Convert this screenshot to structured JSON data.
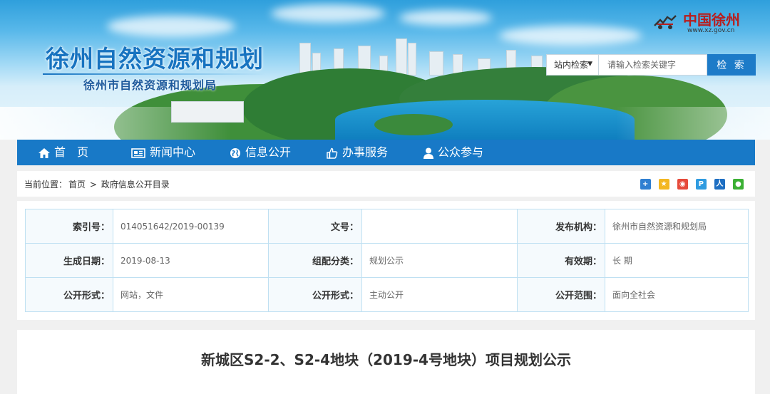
{
  "header": {
    "site_title": "徐州自然资源和规划",
    "site_subtitle": "徐州市自然资源和规划局",
    "logo": {
      "text": "中国徐州",
      "url": "www.xz.gov.cn"
    },
    "search": {
      "scope_label": "站内检索",
      "placeholder": "请输入检索关键字",
      "button_label": "检 索"
    }
  },
  "nav": {
    "items": [
      {
        "label": "首　页",
        "icon": "home-icon"
      },
      {
        "label": "新闻中心",
        "icon": "newspaper-icon"
      },
      {
        "label": "信息公开",
        "icon": "globe-icon"
      },
      {
        "label": "办事服务",
        "icon": "thumbs-up-icon"
      },
      {
        "label": "公众参与",
        "icon": "user-icon"
      }
    ]
  },
  "breadcrumb": {
    "prefix": "当前位置：",
    "home": "首页",
    "separator": ">",
    "current": "政府信息公开目录"
  },
  "share_icons": [
    "plus-share-icon",
    "qzone-icon",
    "weibo-icon",
    "pengyou-icon",
    "renren-icon",
    "wechat-icon"
  ],
  "meta": {
    "index_no": {
      "label": "索引号：",
      "value": "014051642/2019-00139"
    },
    "doc_no": {
      "label": "文号：",
      "value": ""
    },
    "publisher": {
      "label": "发布机构：",
      "value": "徐州市自然资源和规划局"
    },
    "created": {
      "label": "生成日期：",
      "value": "2019-08-13"
    },
    "category": {
      "label": "组配分类：",
      "value": "规划公示"
    },
    "validity": {
      "label": "有效期：",
      "value": "长 期"
    },
    "form": {
      "label": "公开形式：",
      "value": "网站，文件"
    },
    "mode": {
      "label": "公开形式：",
      "value": "主动公开"
    },
    "scope": {
      "label": "公开范围：",
      "value": "面向全社会"
    }
  },
  "article": {
    "title": "新城区S2-2、S2-4地块（2019-4号地块）项目规划公示"
  },
  "colors": {
    "brand_blue": "#1879c7",
    "table_border": "#bfe0f2",
    "logo_red": "#b81d1d"
  }
}
